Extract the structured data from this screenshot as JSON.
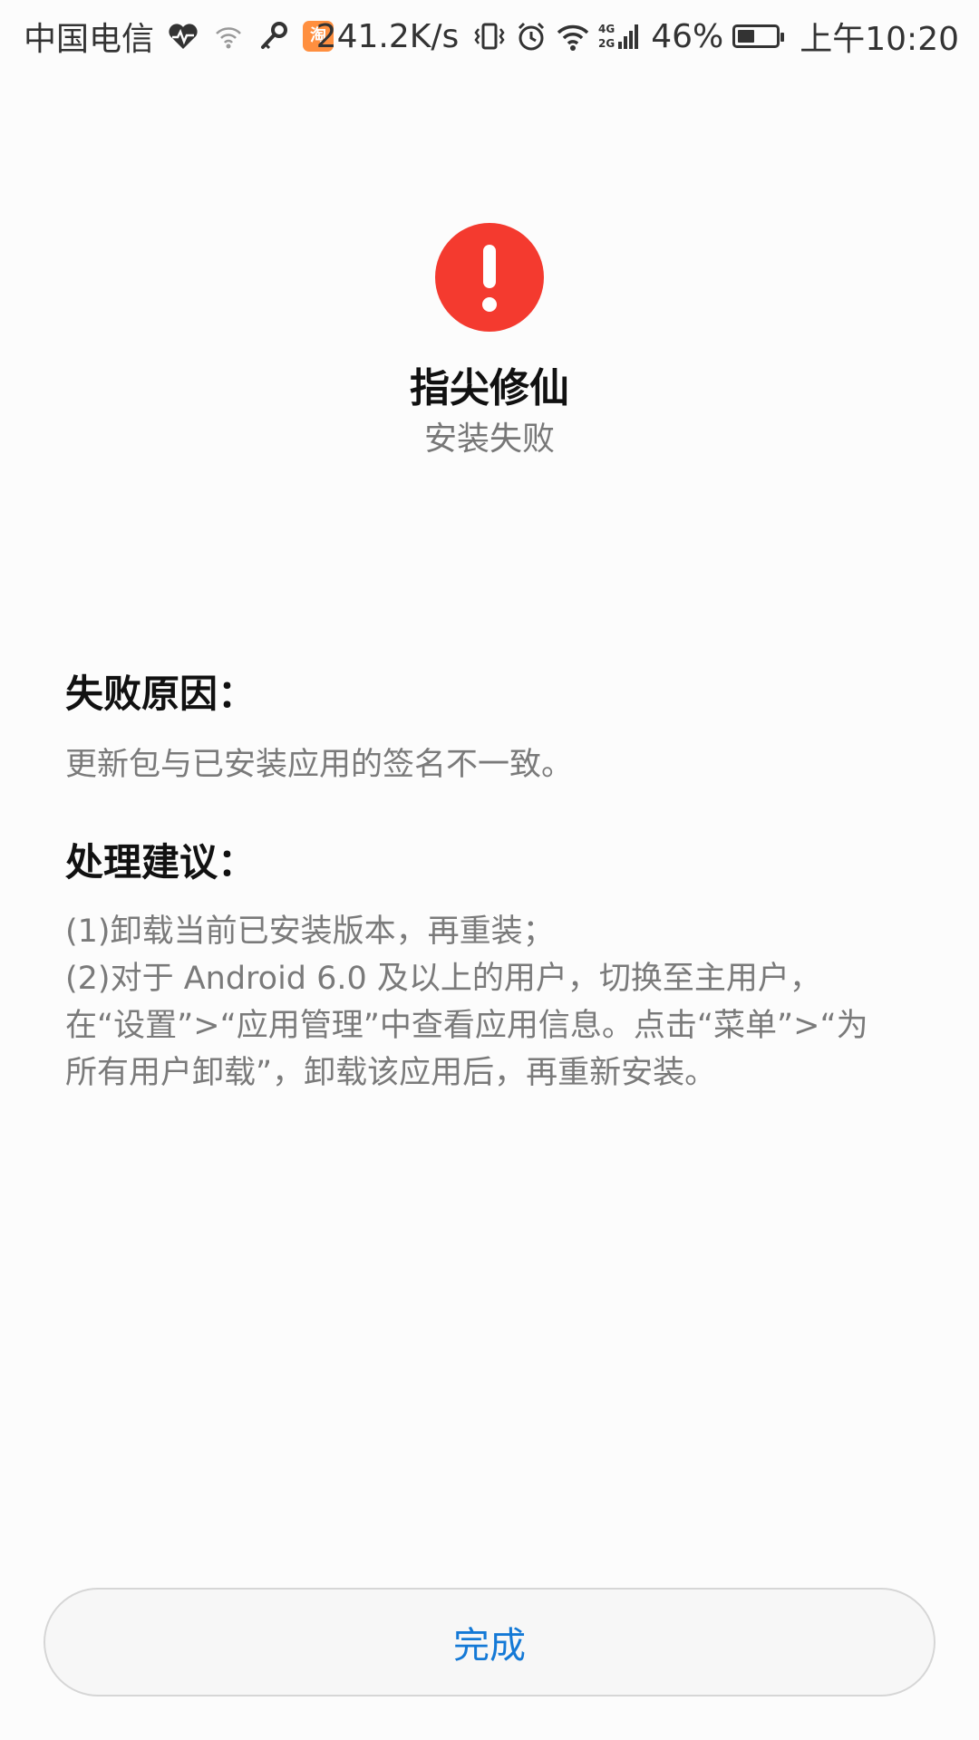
{
  "status_bar": {
    "carrier": "中国电信",
    "taobao_badge": "淘",
    "net_speed": "241.2K/s",
    "network_type": "4G 2G",
    "battery_percent": "46%",
    "battery_level": 0.46,
    "time": "上午10:20",
    "icons": [
      "heart-rate-icon",
      "wifi-hotspot-icon",
      "key-icon",
      "taobao-icon",
      "vibrate-icon",
      "alarm-icon",
      "wifi-icon",
      "signal-icon",
      "battery-icon"
    ]
  },
  "header": {
    "icon": "exclamation-icon",
    "icon_color": "#f43a2f",
    "app_name": "指尖修仙",
    "status": "安装失败"
  },
  "failure": {
    "title": "失败原因：",
    "reason": "更新包与已安装应用的签名不一致。"
  },
  "suggestion": {
    "title": "处理建议：",
    "lines": [
      "(1)卸载当前已安装版本，再重装；",
      "(2)对于 Android 6.0 及以上的用户，切换至主用户，",
      "在“设置”>“应用管理”中查看应用信息。点击“菜单”>“为",
      "所有用户卸载”，卸载该应用后，再重新安装。"
    ]
  },
  "actions": {
    "done_label": "完成",
    "accent_color": "#1479d6"
  }
}
